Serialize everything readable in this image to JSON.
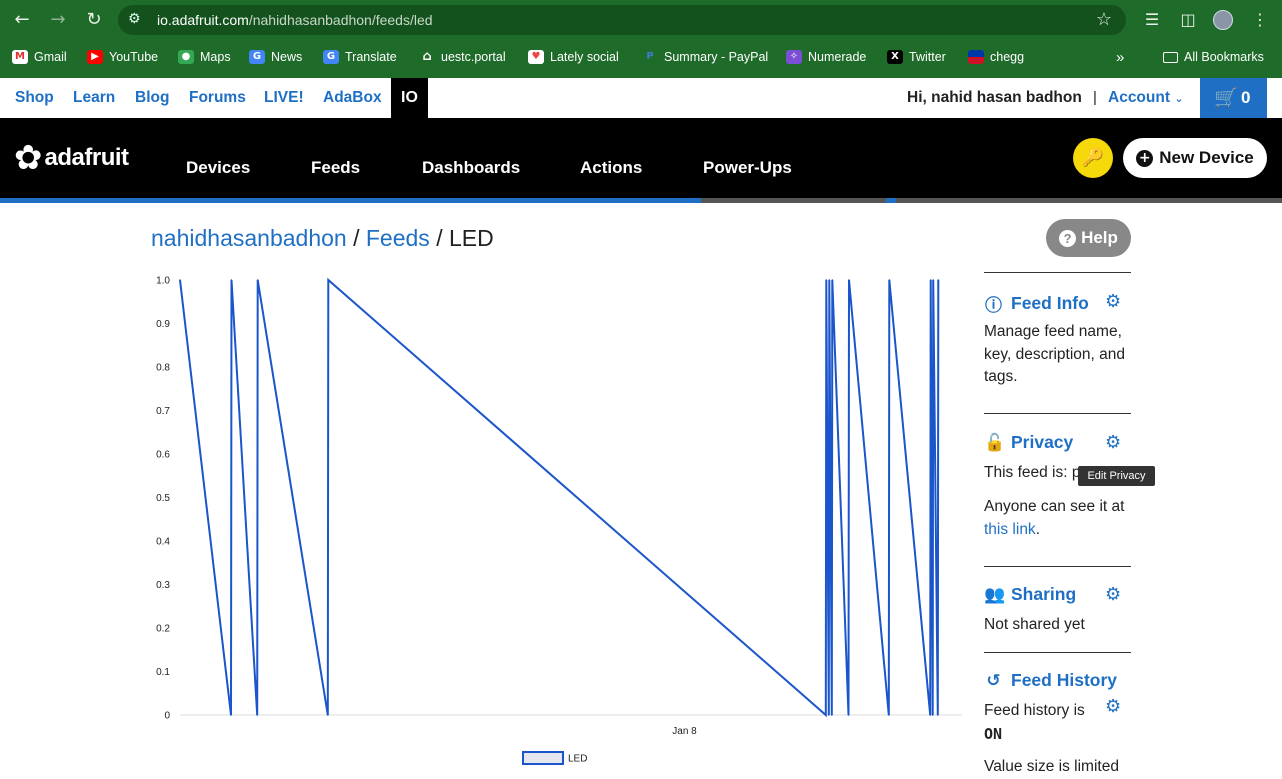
{
  "browser": {
    "url_host": "io.adafruit.com",
    "url_path": "/nahidhasanbadhon/feeds/led",
    "bookmarks": [
      "Gmail",
      "YouTube",
      "Maps",
      "News",
      "Translate",
      "uestc.portal",
      "Lately social",
      "Summary - PayPal",
      "Numerade",
      "Twitter",
      "chegg"
    ],
    "all_bookmarks": "All Bookmarks"
  },
  "topbar": {
    "links": [
      "Shop",
      "Learn",
      "Blog",
      "Forums",
      "LIVE!",
      "AdaBox"
    ],
    "active_tab": "IO",
    "greeting": "Hi, nahid hasan badhon",
    "separator": "|",
    "account": "Account",
    "cart_count": "0"
  },
  "nav": {
    "logo": "adafruit",
    "items": [
      "Devices",
      "Feeds",
      "Dashboards",
      "Actions",
      "Power-Ups"
    ],
    "new_device": "New Device",
    "colors": {
      "accent": "#1f6fc5",
      "key": "#f5d90a"
    }
  },
  "breadcrumb": {
    "user": "nahidhasanbadhon",
    "sep1": "/",
    "feeds": "Feeds",
    "sep2": "/",
    "current": "LED"
  },
  "help": "Help",
  "chart_data": {
    "type": "line",
    "series": [
      {
        "name": "LED",
        "x": [
          0,
          0.101,
          0.102,
          0.153,
          0.154,
          0.293,
          0.294,
          1.28,
          1.281,
          1.286,
          1.287,
          1.292,
          1.293,
          1.325,
          1.326,
          1.405,
          1.406,
          1.487,
          1.488,
          1.492,
          1.493,
          1.502,
          1.503
        ],
        "values": [
          1,
          0,
          1,
          0,
          1,
          0,
          1,
          0,
          1,
          0,
          1,
          0,
          1,
          0,
          1,
          0,
          1,
          0,
          1,
          0,
          1,
          0,
          1
        ]
      }
    ],
    "x_tick_labels": [
      "Jan 8"
    ],
    "x_tick_positions": [
      1
    ],
    "yticks": [
      "0",
      "0.1",
      "0.2",
      "0.3",
      "0.4",
      "0.5",
      "0.6",
      "0.7",
      "0.8",
      "0.9",
      "1.0"
    ],
    "ylim": [
      0,
      1
    ],
    "xlim": [
      0,
      1.55
    ],
    "legend": "bottom",
    "color": "#1a55cc"
  },
  "sidebar": {
    "feed_info": {
      "title": "Feed Info",
      "desc": "Manage feed name, key, description, and tags."
    },
    "privacy": {
      "title": "Privacy",
      "status_prefix": "This feed is:",
      "status_partial": "p",
      "desc_prefix": "Anyone can see it at",
      "link": "this link",
      "desc_suffix": "."
    },
    "tooltip": "Edit Privacy",
    "sharing": {
      "title": "Sharing",
      "desc": "Not shared yet"
    },
    "history": {
      "title": "Feed History",
      "desc": "Feed history is",
      "state": "ON",
      "note": "Value size is limited"
    }
  }
}
